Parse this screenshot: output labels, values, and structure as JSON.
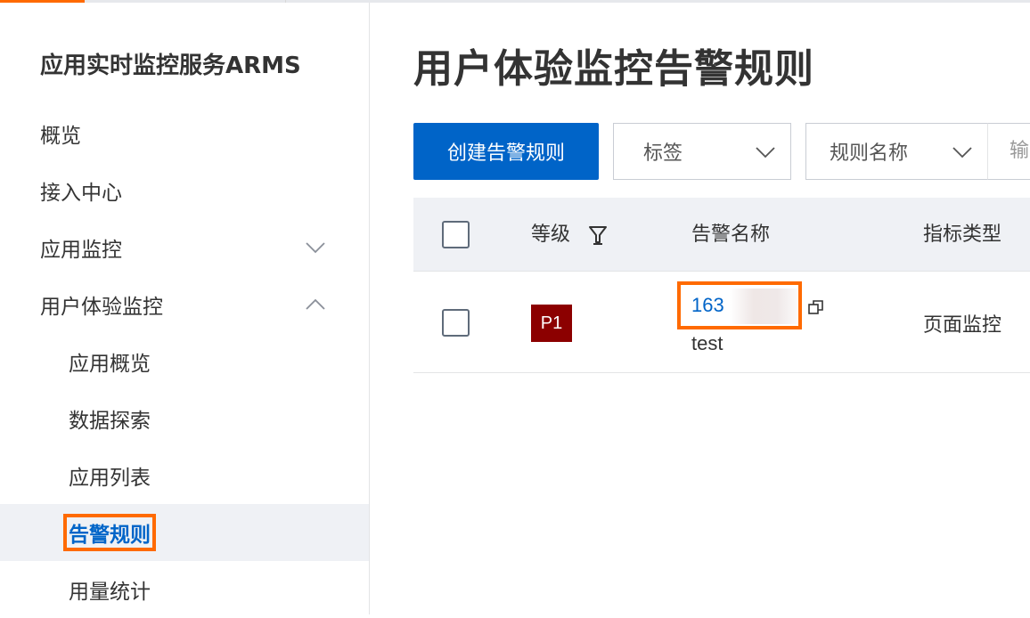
{
  "sidebar": {
    "product_title": "应用实时监控服务ARMS",
    "items": [
      {
        "label": "概览"
      },
      {
        "label": "接入中心"
      },
      {
        "label": "应用监控",
        "expandable": true,
        "expanded": false
      },
      {
        "label": "用户体验监控",
        "expandable": true,
        "expanded": true
      },
      {
        "label": "应用概览"
      },
      {
        "label": "数据探索"
      },
      {
        "label": "应用列表"
      },
      {
        "label": "告警规则",
        "active": true
      },
      {
        "label": "用量统计"
      }
    ]
  },
  "main": {
    "page_title": "用户体验监控告警规则",
    "toolbar": {
      "create_label": "创建告警规则",
      "tag_select": "标签",
      "rule_name_select": "规则名称",
      "search_placeholder": "输"
    },
    "table": {
      "columns": [
        "等级",
        "告警名称",
        "指标类型"
      ],
      "rows": [
        {
          "level": "P1",
          "name": "163",
          "name_sub": "test",
          "metric_type": "页面监控"
        }
      ]
    }
  },
  "colors": {
    "primary": "#0064c8",
    "accent_orange": "#ff6a00",
    "badge_p1": "#8c0000",
    "header_bg": "#eff1f5"
  },
  "icons": [
    "chevron-down-icon",
    "chevron-up-icon",
    "filter-icon",
    "copy-icon"
  ]
}
